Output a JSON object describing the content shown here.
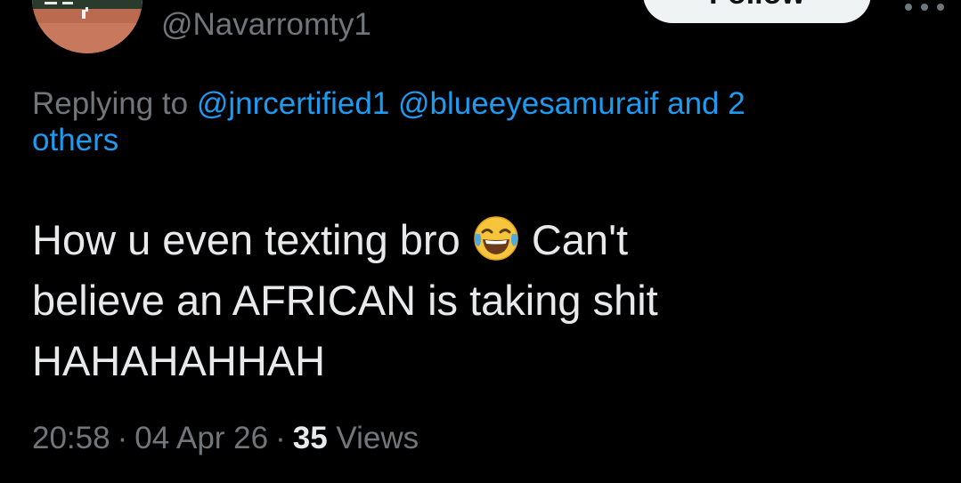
{
  "tweet": {
    "handle": "@Navarromty1",
    "follow_label": "Follow",
    "reply": {
      "prefix": "Replying to",
      "mention_1": "@jnrcertified1",
      "mention_2": "@blueeyesamuraif",
      "and_n": "and 2",
      "others": "others"
    },
    "text": {
      "line1_a": "How u even texting bro",
      "emoji": "face-with-tears-of-joy",
      "line1_b": "Can't",
      "line2": "believe an AFRICAN is taking shit",
      "line3": "HAHAHAHHAH"
    },
    "meta": {
      "time": "20:58",
      "separator": "·",
      "date": "04 Apr 26",
      "views_count": "35",
      "views_label": "Views"
    }
  },
  "colors": {
    "background": "#000000",
    "text_primary": "#e7e9ea",
    "text_secondary": "#71767b",
    "link": "#1d9bf0",
    "button_bg": "#eff3f4"
  }
}
